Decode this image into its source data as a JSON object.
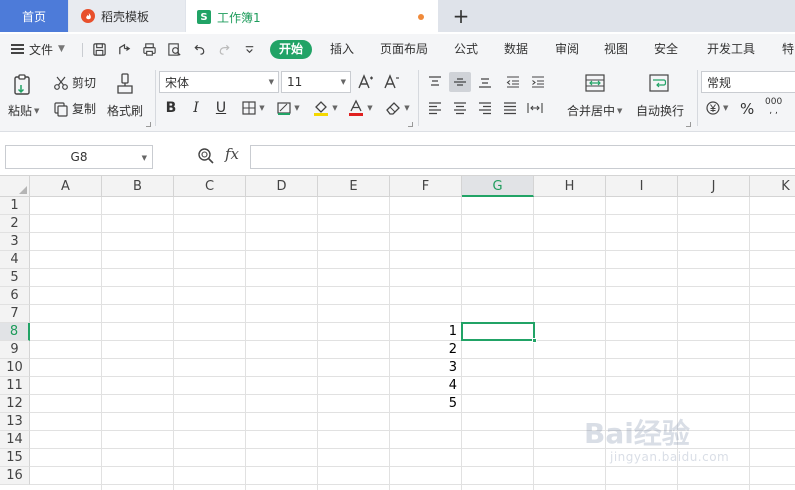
{
  "tabs": {
    "home": "首页",
    "templates": "稻壳模板",
    "workbook": "工作簿1",
    "workbook_icon": "S"
  },
  "menu": {
    "file": "文件",
    "items": [
      "开始",
      "插入",
      "页面布局",
      "公式",
      "数据",
      "审阅",
      "视图",
      "安全",
      "开发工具",
      "特"
    ]
  },
  "ribbon": {
    "paste": "粘贴",
    "cut": "剪切",
    "copy": "复制",
    "format_painter": "格式刷",
    "font_name": "宋体",
    "font_size": "11",
    "bold": "B",
    "italic": "I",
    "underline": "U",
    "merge_center": "合并居中",
    "wrap_text": "自动换行",
    "number_format": "常规",
    "percent": "%",
    "thousands": "000"
  },
  "formula_bar": {
    "name_box": "G8",
    "fx": "fx",
    "value": ""
  },
  "grid": {
    "columns": [
      "A",
      "B",
      "C",
      "D",
      "E",
      "F",
      "G",
      "H",
      "I",
      "J",
      "K"
    ],
    "rows": [
      "1",
      "2",
      "3",
      "4",
      "5",
      "6",
      "7",
      "8",
      "9",
      "10",
      "11",
      "12",
      "13",
      "14",
      "15",
      "16"
    ],
    "selected_column": "G",
    "selected_row": "8",
    "cells": [
      {
        "ref": "F8",
        "value": "1"
      },
      {
        "ref": "F9",
        "value": "2"
      },
      {
        "ref": "F10",
        "value": "3"
      },
      {
        "ref": "F11",
        "value": "4"
      },
      {
        "ref": "F12",
        "value": "5"
      }
    ]
  },
  "watermark": {
    "logo": "Bai经验",
    "url": "jingyan.baidu.com"
  },
  "colors": {
    "accent": "#21a366",
    "home_tab": "#4d7bd9",
    "modified_dot": "#f08a3a"
  }
}
